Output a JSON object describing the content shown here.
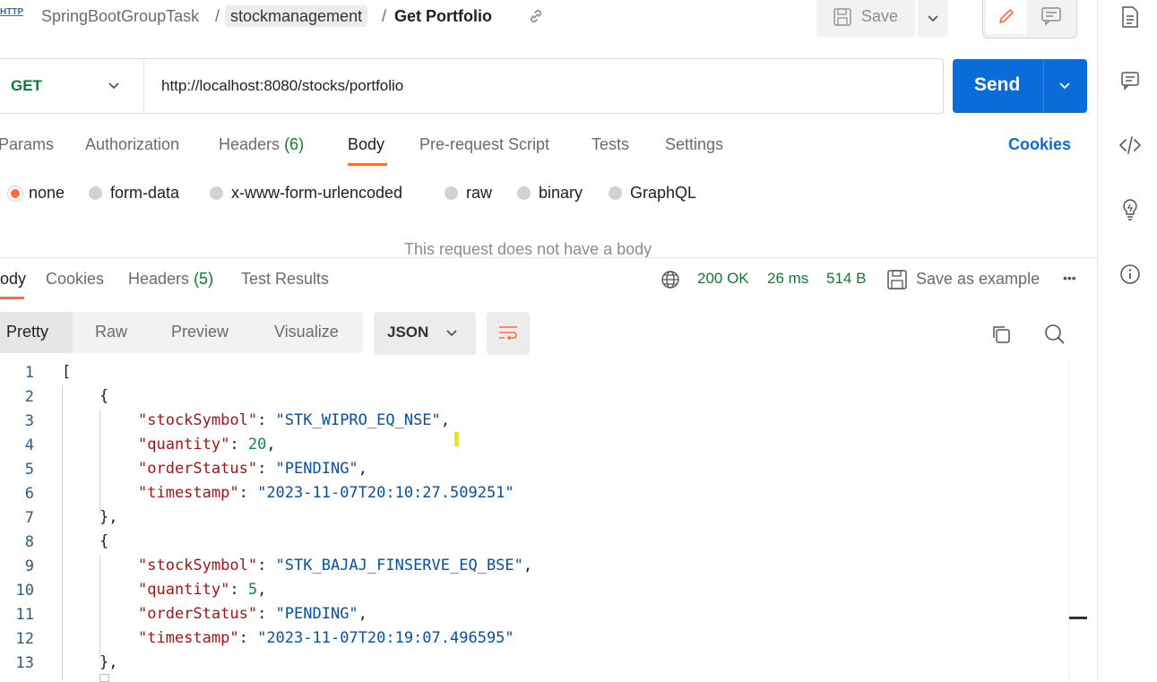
{
  "header": {
    "http_badge": "HTTP",
    "workspace": "SpringBootGroupTask",
    "collection": "stockmanagement",
    "request_name": "Get Portfolio",
    "separator": "/",
    "save_label": "Save"
  },
  "request": {
    "method": "GET",
    "url": "http://localhost:8080/stocks/portfolio",
    "send_label": "Send"
  },
  "request_tabs": {
    "params": "Params",
    "authorization": "Authorization",
    "headers": "Headers",
    "headers_count": "(6)",
    "body": "Body",
    "prerequest": "Pre-request Script",
    "tests": "Tests",
    "settings": "Settings",
    "cookies": "Cookies"
  },
  "body_types": {
    "none": "none",
    "form_data": "form-data",
    "urlencoded": "x-www-form-urlencoded",
    "raw": "raw",
    "binary": "binary",
    "graphql": "GraphQL",
    "selected": "none",
    "empty_message": "This request does not have a body"
  },
  "response_tabs": {
    "body": "ody",
    "cookies": "Cookies",
    "headers": "Headers",
    "headers_count": "(5)",
    "test_results": "Test Results"
  },
  "response_meta": {
    "status": "200 OK",
    "time": "26 ms",
    "size": "514 B",
    "save_example": "Save as example",
    "more": "•••"
  },
  "view_modes": {
    "pretty": "Pretty",
    "raw": "Raw",
    "preview": "Preview",
    "visualize": "Visualize",
    "format": "JSON"
  },
  "code": {
    "l1": "1",
    "l2": "2",
    "l3": "3",
    "l4": "4",
    "l5": "5",
    "l6": "6",
    "l7": "7",
    "l8": "8",
    "l9": "9",
    "l10": "10",
    "l11": "11",
    "l12": "12",
    "l13": "13",
    "open_bracket": "[",
    "open_brace": "{",
    "close_brace": "},",
    "k_symbol": "\"stockSymbol\"",
    "k_quantity": "\"quantity\"",
    "k_status": "\"orderStatus\"",
    "k_timestamp": "\"timestamp\"",
    "colon": ": ",
    "comma": ",",
    "item1_symbol": "\"STK_WIPRO_EQ_NSE\"",
    "item1_quantity": "20",
    "item1_status": "\"PENDING\"",
    "item1_timestamp": "\"2023-11-07T20:10:27.509251\"",
    "item2_symbol": "\"STK_BAJAJ_FINSERVE_EQ_BSE\"",
    "item2_quantity": "5",
    "item2_status": "\"PENDING\"",
    "item2_timestamp": "\"2023-11-07T20:19:07.496595\""
  },
  "colors": {
    "accent": "#ff6c37",
    "send": "#0a6cd9",
    "success": "#0f7a36"
  }
}
